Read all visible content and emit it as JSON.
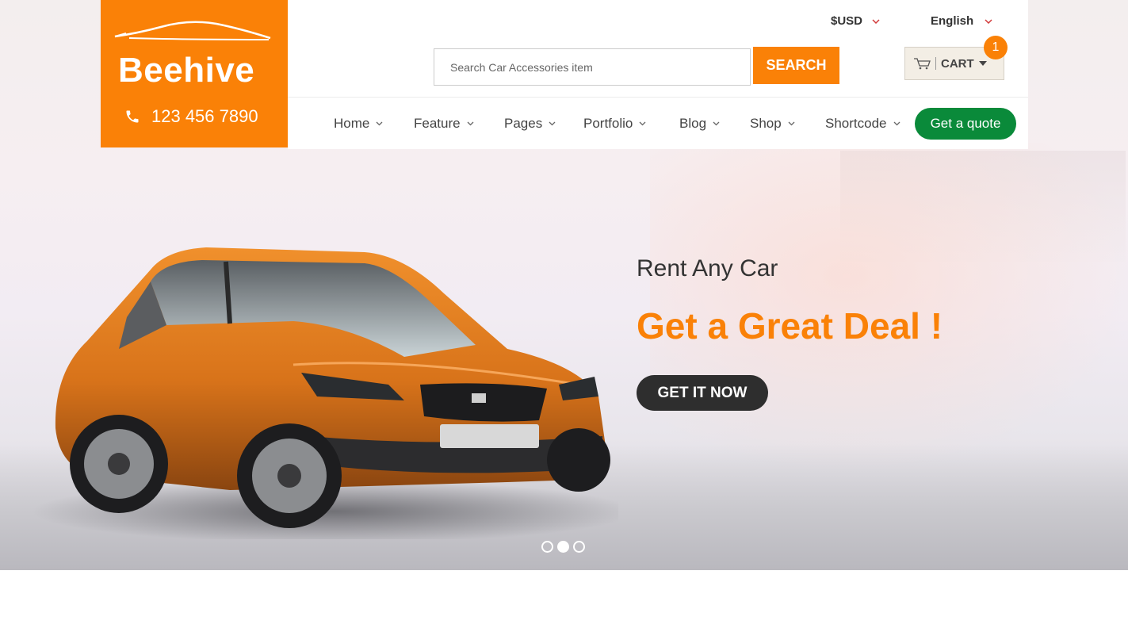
{
  "header": {
    "brand": "Beehive",
    "phone": "123 456 7890",
    "currency": "$USD",
    "language": "English",
    "search": {
      "placeholder": "Search Car Accessories item",
      "button": "SEARCH"
    },
    "cart": {
      "label": "CART",
      "count": "1"
    }
  },
  "nav": {
    "items": [
      {
        "label": "Home"
      },
      {
        "label": "Feature"
      },
      {
        "label": "Pages"
      },
      {
        "label": "Portfolio"
      },
      {
        "label": "Blog"
      },
      {
        "label": "Shop"
      },
      {
        "label": "Shortcode"
      }
    ],
    "cta": "Get a quote"
  },
  "hero": {
    "subtitle": "Rent Any Car",
    "title": "Get a Great Deal !",
    "button": "GET IT NOW",
    "slides_total": 3,
    "active_slide": 2
  },
  "colors": {
    "brand_orange": "#fa8107",
    "cta_green": "#0a8a3a",
    "dark_button": "#2e2e2e"
  }
}
